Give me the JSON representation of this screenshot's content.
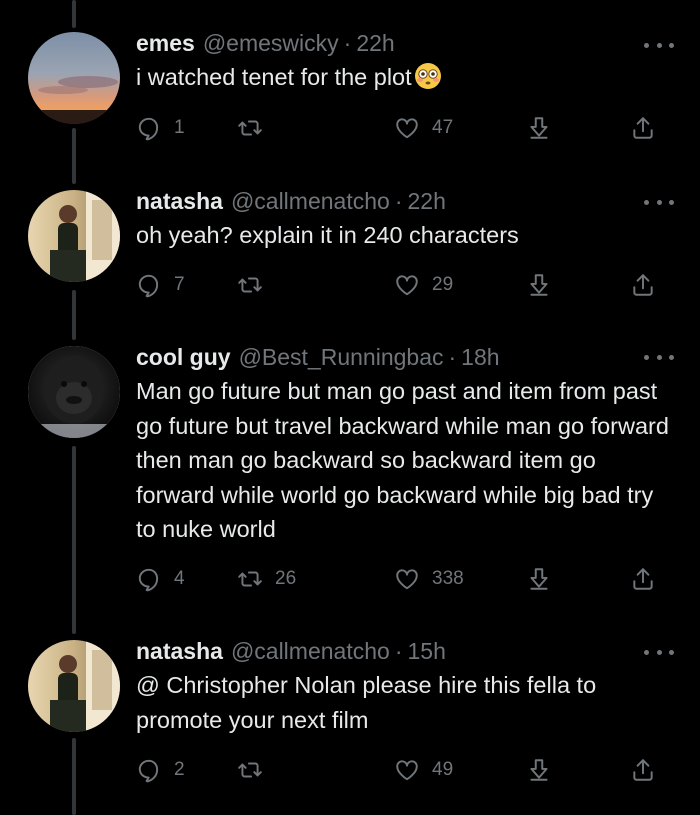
{
  "tweets": [
    {
      "name": "emes",
      "handle": "@emeswicky",
      "time": "22h",
      "text": "i watched tenet for the plot",
      "emoji": "flushed-face-emoji",
      "replies": "1",
      "retweets": "",
      "likes": "47"
    },
    {
      "name": "natasha",
      "handle": "@callmenatcho",
      "time": "22h",
      "text": "oh yeah? explain it in 240 characters",
      "replies": "7",
      "retweets": "",
      "likes": "29"
    },
    {
      "name": "cool guy",
      "handle": "@Best_Runningbac",
      "time": "18h",
      "text": "Man go future but man go past and item from past go future but travel backward while man go forward then man go backward so backward item go forward while world go backward while big bad try to nuke world",
      "replies": "4",
      "retweets": "26",
      "likes": "338"
    },
    {
      "name": "natasha",
      "handle": "@callmenatcho",
      "time": "15h",
      "text": "@ Christopher Nolan please hire this fella to promote your next film",
      "replies": "2",
      "retweets": "",
      "likes": "49"
    }
  ],
  "separator": "·",
  "colors": {
    "background": "#000000",
    "text": "#e7e9ea",
    "muted": "#71767b",
    "thread_line": "#333639"
  },
  "icons": [
    "reply-icon",
    "retweet-icon",
    "like-icon",
    "download-icon",
    "share-icon",
    "more-icon"
  ]
}
